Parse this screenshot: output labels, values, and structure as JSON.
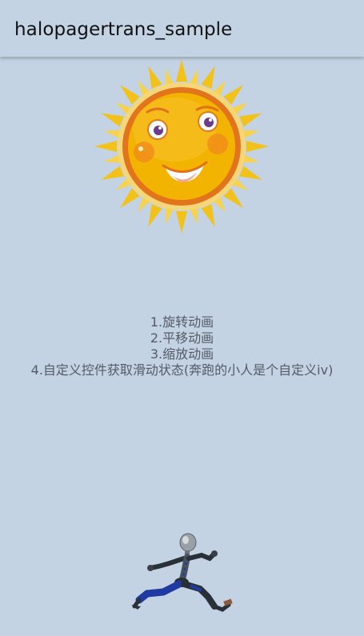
{
  "app": {
    "title": "halopagertrans_sample"
  },
  "content": {
    "lines": [
      "1.旋转动画",
      "2.平移动画",
      "3.缩放动画",
      "4.自定义控件获取滑动状态(奔跑的小人是个自定义iv)"
    ]
  },
  "images": {
    "sun": "smiling-sun",
    "runner": "running-robot-figure"
  },
  "colors": {
    "background": "#c3d3e3",
    "sun_ray": "#f2c21b",
    "sun_ring": "#e2751b",
    "sun_face": "#f3b400"
  }
}
